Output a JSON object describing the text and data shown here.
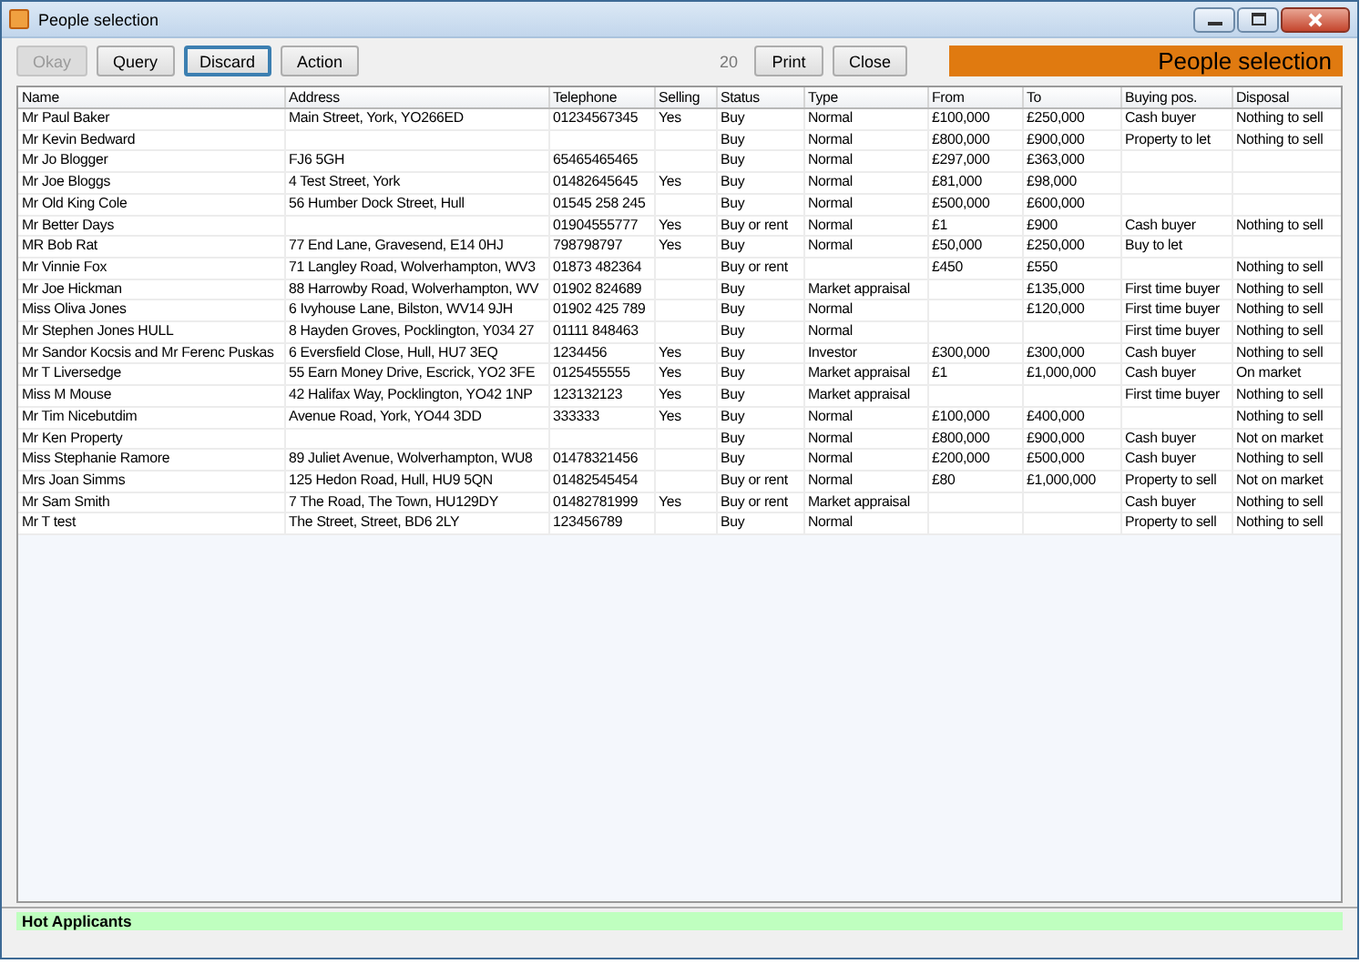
{
  "window": {
    "title": "People selection"
  },
  "toolbar": {
    "left_buttons": [
      {
        "label": "Okay",
        "disabled": true,
        "focused": false
      },
      {
        "label": "Query",
        "disabled": false,
        "focused": false
      },
      {
        "label": "Discard",
        "disabled": false,
        "focused": true
      },
      {
        "label": "Action",
        "disabled": false,
        "focused": false
      }
    ],
    "count": "20",
    "right_buttons": [
      {
        "label": "Print",
        "disabled": false,
        "focused": false
      },
      {
        "label": "Close",
        "disabled": false,
        "focused": false
      }
    ],
    "banner": "People selection"
  },
  "table": {
    "columns": [
      "Name",
      "Address",
      "Telephone",
      "Selling",
      "Status",
      "Type",
      "From",
      "To",
      "Buying pos.",
      "Disposal"
    ],
    "rows": [
      [
        "Mr Paul Baker",
        "Main Street, York, YO266ED",
        "01234567345",
        "Yes",
        "Buy",
        "Normal",
        "£100,000",
        "£250,000",
        "Cash buyer",
        "Nothing to sell"
      ],
      [
        "Mr Kevin Bedward",
        "",
        "",
        "",
        "Buy",
        "Normal",
        "£800,000",
        "£900,000",
        "Property to let",
        "Nothing to sell"
      ],
      [
        "Mr Jo Blogger",
        "FJ6 5GH",
        "65465465465",
        "",
        "Buy",
        "Normal",
        "£297,000",
        "£363,000",
        "",
        ""
      ],
      [
        "Mr Joe Bloggs",
        "4 Test Street, York",
        "01482645645",
        "Yes",
        "Buy",
        "Normal",
        "£81,000",
        "£98,000",
        "",
        ""
      ],
      [
        "Mr Old King Cole",
        "56 Humber Dock Street, Hull",
        "01545 258 245",
        "",
        "Buy",
        "Normal",
        "£500,000",
        "£600,000",
        "",
        ""
      ],
      [
        "Mr Better Days",
        "",
        "01904555777",
        "Yes",
        "Buy or rent",
        "Normal",
        "£1",
        "£900",
        "Cash buyer",
        "Nothing to sell"
      ],
      [
        "MR Bob Rat",
        "77 End Lane, Gravesend, E14 0HJ",
        "798798797",
        "Yes",
        "Buy",
        "Normal",
        "£50,000",
        "£250,000",
        "Buy to let",
        ""
      ],
      [
        "Mr Vinnie Fox",
        "71 Langley Road, Wolverhampton, WV3",
        "01873 482364",
        "",
        "Buy or rent",
        "",
        "£450",
        "£550",
        "",
        "Nothing to sell"
      ],
      [
        "Mr Joe Hickman",
        "88 Harrowby Road, Wolverhampton, WV",
        "01902 824689",
        "",
        "Buy",
        "Market appraisal",
        "",
        "£135,000",
        "First time buyer",
        "Nothing to sell"
      ],
      [
        "Miss Oliva Jones",
        "6 Ivyhouse Lane, Bilston, WV14 9JH",
        "01902 425 789",
        "",
        "Buy",
        "Normal",
        "",
        "£120,000",
        "First time buyer",
        "Nothing to sell"
      ],
      [
        "Mr Stephen Jones HULL",
        "8 Hayden Groves, Pocklington, Y034 27",
        "01111 848463",
        "",
        "Buy",
        "Normal",
        "",
        "",
        "First time buyer",
        "Nothing to sell"
      ],
      [
        "Mr Sandor Kocsis and Mr Ferenc Puskas",
        "6 Eversfield Close, Hull, HU7 3EQ",
        "1234456",
        "Yes",
        "Buy",
        "Investor",
        "£300,000",
        "£300,000",
        "Cash buyer",
        "Nothing to sell"
      ],
      [
        "Mr T Liversedge",
        "55 Earn Money Drive, Escrick, YO2 3FE",
        "0125455555",
        "Yes",
        "Buy",
        "Market appraisal",
        "£1",
        "£1,000,000",
        "Cash buyer",
        "On market"
      ],
      [
        "Miss M Mouse",
        "42 Halifax Way, Pocklington, YO42 1NP",
        "123132123",
        "Yes",
        "Buy",
        "Market appraisal",
        "",
        "",
        "First time buyer",
        "Nothing to sell"
      ],
      [
        "Mr Tim Nicebutdim",
        "Avenue Road, York, YO44 3DD",
        "333333",
        "Yes",
        "Buy",
        "Normal",
        "£100,000",
        "£400,000",
        "",
        "Nothing to sell"
      ],
      [
        "Mr Ken Property",
        "",
        "",
        "",
        "Buy",
        "Normal",
        "£800,000",
        "£900,000",
        "Cash buyer",
        "Not on market"
      ],
      [
        "Miss Stephanie Ramore",
        "89 Juliet Avenue, Wolverhampton, WU8",
        "01478321456",
        "",
        "Buy",
        "Normal",
        "£200,000",
        "£500,000",
        "Cash buyer",
        "Nothing to sell"
      ],
      [
        "Mrs Joan Simms",
        "125 Hedon Road, Hull, HU9 5QN",
        "01482545454",
        "",
        "Buy or rent",
        "Normal",
        "£80",
        "£1,000,000",
        "Property to sell",
        "Not on market"
      ],
      [
        "Mr Sam Smith",
        "7 The Road, The Town, HU129DY",
        "01482781999",
        "Yes",
        "Buy or rent",
        "Market appraisal",
        "",
        "",
        "Cash buyer",
        "Nothing to sell"
      ],
      [
        "Mr T test",
        "The Street, Street, BD6 2LY",
        "123456789",
        "",
        "Buy",
        "Normal",
        "",
        "",
        "Property to sell",
        "Nothing to sell"
      ]
    ]
  },
  "status_bar": {
    "label": "Hot Applicants"
  }
}
